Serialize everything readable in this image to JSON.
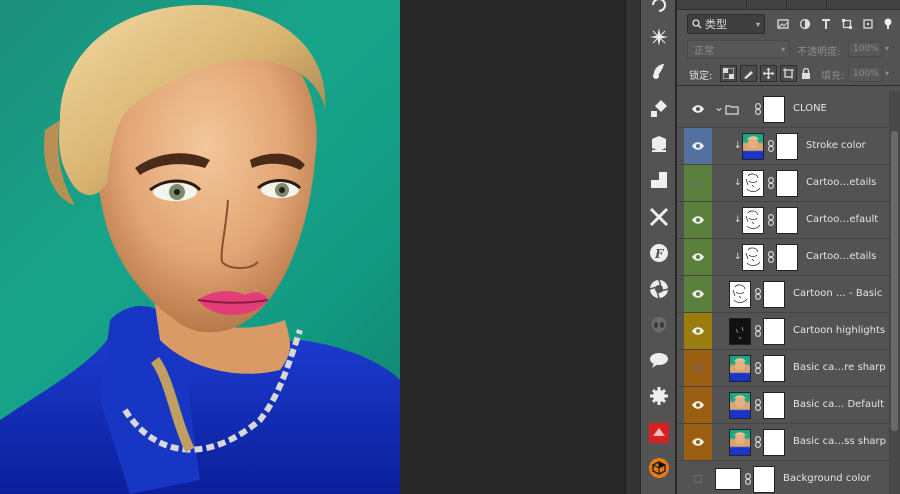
{
  "colors": {
    "canvas_bg": "#282828",
    "panel_bg": "#535353",
    "vis_blue": "#5470a0",
    "vis_green": "#5b7f3c",
    "vis_yellow": "#9a7d0f",
    "vis_orange": "#9a5f12",
    "teal_backdrop": "#17a58a"
  },
  "toolbar": {
    "tools": [
      {
        "icon": "rotate-icon"
      },
      {
        "icon": "sparkle-icon"
      },
      {
        "icon": "brush-icon"
      },
      {
        "icon": "shapes-icon"
      },
      {
        "icon": "layers-icon"
      },
      {
        "icon": "crop-frame-icon"
      },
      {
        "icon": "cross-tools-icon"
      },
      {
        "icon": "font-f-icon"
      },
      {
        "icon": "aperture-icon"
      },
      {
        "icon": "alien-icon"
      },
      {
        "icon": "speech-bubble-icon"
      },
      {
        "icon": "gear-cog-icon"
      },
      {
        "icon": "red-app-icon"
      },
      {
        "icon": "orange-cube-icon"
      }
    ]
  },
  "layers_panel": {
    "filter_label": "类型",
    "blend_mode": "正常",
    "opacity_label": "不透明度:",
    "opacity_value": "100%",
    "lock_label": "锁定:",
    "fill_label": "填充:",
    "fill_value": "100%",
    "layers": [
      {
        "name": "CLONE",
        "visible": true,
        "color": "none",
        "type": "group"
      },
      {
        "name": "Stroke color",
        "visible": true,
        "color": "blue",
        "type": "photo",
        "clipped": true
      },
      {
        "name": "Cartoo…etails",
        "visible": false,
        "color": "green",
        "type": "sketch",
        "clipped": true
      },
      {
        "name": "Cartoo…efault",
        "visible": true,
        "color": "green",
        "type": "sketch",
        "clipped": true
      },
      {
        "name": "Cartoo…etails",
        "visible": true,
        "color": "green",
        "type": "sketch",
        "clipped": true
      },
      {
        "name": "Cartoon … - Basic",
        "visible": true,
        "color": "green",
        "type": "sketch",
        "clipped": false
      },
      {
        "name": "Cartoon highlights",
        "visible": true,
        "color": "yellow",
        "type": "dark",
        "clipped": false
      },
      {
        "name": "Basic ca…re sharp",
        "visible": false,
        "color": "orange",
        "type": "photo",
        "clipped": false
      },
      {
        "name": "Basic ca… Default",
        "visible": true,
        "color": "orange",
        "type": "photo",
        "clipped": false
      },
      {
        "name": "Basic ca…ss sharp",
        "visible": true,
        "color": "orange",
        "type": "photo",
        "clipped": false
      },
      {
        "name": "Background color",
        "visible": false,
        "color": "none",
        "type": "white",
        "clipped": false
      }
    ]
  }
}
